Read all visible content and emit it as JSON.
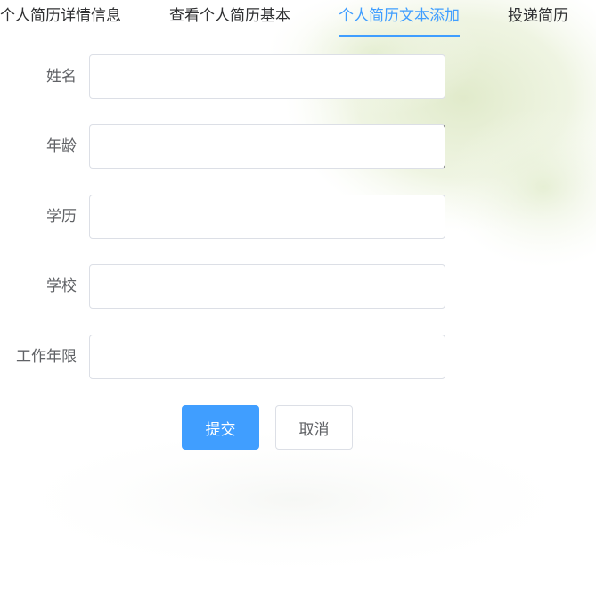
{
  "tabs": [
    {
      "label": "个人简历详情信息",
      "active": false
    },
    {
      "label": "查看个人简历基本",
      "active": false
    },
    {
      "label": "个人简历文本添加",
      "active": true
    },
    {
      "label": "投递简历",
      "active": false
    }
  ],
  "form": {
    "fields": [
      {
        "label": "姓名",
        "value": "",
        "placeholder": ""
      },
      {
        "label": "年龄",
        "value": "",
        "placeholder": ""
      },
      {
        "label": "学历",
        "value": "",
        "placeholder": ""
      },
      {
        "label": "学校",
        "value": "",
        "placeholder": ""
      },
      {
        "label": "工作年限",
        "value": "",
        "placeholder": ""
      }
    ],
    "submit_label": "提交",
    "cancel_label": "取消"
  },
  "colors": {
    "accent": "#409eff",
    "text": "#303133",
    "label": "#606266",
    "border": "#dcdfe6"
  }
}
